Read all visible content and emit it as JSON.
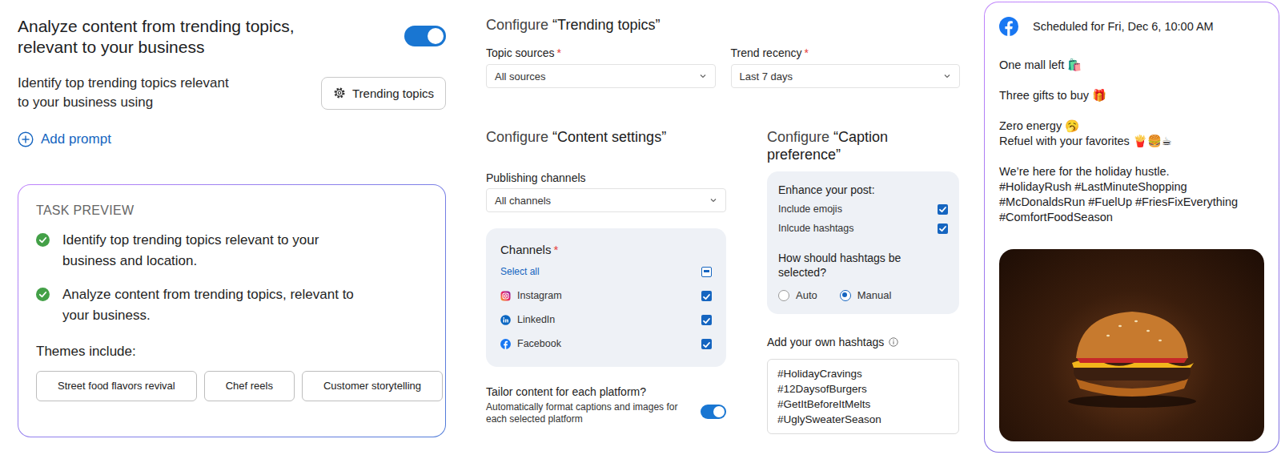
{
  "intro": {
    "title": "Analyze content from trending topics, relevant to your business",
    "toggle_on": true,
    "subtitle": "Identify top trending topics relevant to your business using",
    "trending_button": "Trending topics",
    "add_prompt": "Add prompt"
  },
  "task_preview": {
    "heading": "TASK PREVIEW",
    "items": [
      {
        "text": "Identify top trending topics relevant to your business and location.",
        "done": true
      },
      {
        "text": "Analyze content from trending topics, relevant to your business.",
        "done": true
      }
    ],
    "themes_label": "Themes include:",
    "themes": [
      "Street food flavors revival",
      "Chef reels",
      "Customer storytelling"
    ]
  },
  "trending_topics": {
    "prefix": "Configure",
    "name": "“Trending topics”",
    "fields": [
      {
        "label": "Topic sources",
        "required_mark": "*",
        "value": "All sources"
      },
      {
        "label": "Trend recency",
        "required_mark": "*",
        "value": "Last 7 days"
      }
    ]
  },
  "content_settings": {
    "prefix": "Configure",
    "name": "“Content settings”",
    "publishing_label": "Publishing channels",
    "publishing_value": "All channels",
    "channels_label": "Channels",
    "channels_required_mark": "*",
    "select_all": {
      "label": "Select all",
      "checked": false,
      "indeterminate": true
    },
    "channels": [
      {
        "name": "Instagram",
        "kind": "instagram",
        "checked": true
      },
      {
        "name": "LinkedIn",
        "kind": "linkedin",
        "checked": true
      },
      {
        "name": "Facebook",
        "kind": "facebook",
        "checked": true
      }
    ],
    "tailor_label": "Tailor content for each platform?",
    "tailor_on": true,
    "tailor_hint": "Automatically format captions and images for each selected platform"
  },
  "caption_preference": {
    "prefix": "Configure",
    "name": "“Caption preference”",
    "enhance_label": "Enhance your post:",
    "options": [
      {
        "label": "Include emojis",
        "checked": true
      },
      {
        "label": "Inlcude hashtags",
        "checked": true
      }
    ],
    "hashtag_question": "How should hashtags be selected?",
    "hashtag_modes": [
      {
        "label": "Auto",
        "selected": false
      },
      {
        "label": "Manual",
        "selected": true
      }
    ],
    "own_hashtags_label": "Add your own hashtags",
    "own_hashtags": [
      "#HolidayCravings",
      "#12DaysofBurgers",
      "#GetItBeforeItMelts",
      "#UglySweaterSeason"
    ]
  },
  "post": {
    "schedule": "Scheduled for Fri, Dec 6, 10:00 AM",
    "paragraphs": [
      [
        "One mall left 🛍️"
      ],
      [
        "Three gifts to buy 🎁"
      ],
      [
        "Zero energy 🥱",
        "Refuel with your favorites 🍟🍔☕"
      ],
      [
        "We’re here for the holiday hustle.",
        "#HolidayRush #LastMinuteShopping",
        "#McDonaldsRun #FuelUp #FriesFixEverything",
        "#ComfortFoodSeason"
      ]
    ]
  }
}
